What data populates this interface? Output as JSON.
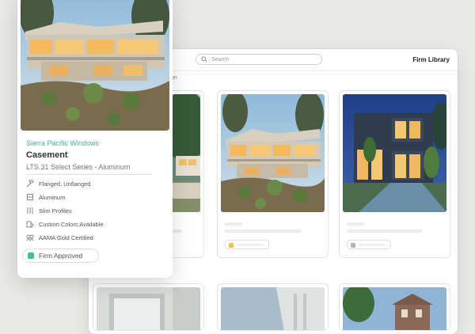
{
  "library": {
    "brand": "Firm Library",
    "search_placeholder": "Search",
    "section_label_tail": "on"
  },
  "detail_card": {
    "manufacturer": "Sierra Pacific Windows",
    "product_name": "Casement",
    "series": "LTS.31 Select Series - Aluminum",
    "features": [
      {
        "icon": "hammer-icon",
        "label": "Flanged, Unflanged"
      },
      {
        "icon": "material-icon",
        "label": "Aluminum"
      },
      {
        "icon": "profile-lines-icon",
        "label": "Slim Profiles"
      },
      {
        "icon": "palette-icon",
        "label": "Custom Colors Available"
      },
      {
        "icon": "certification-icon",
        "label": "AAMA Gold Certified"
      }
    ],
    "status_label": "Firm Approved",
    "status_color": "#3fc38e"
  },
  "cards": [
    {
      "chip_color": null
    },
    {
      "chip_color": "#f4c04a"
    },
    {
      "chip_color": "#b5b5b5"
    }
  ],
  "colors": {
    "accent_green": "#3fb58a"
  }
}
